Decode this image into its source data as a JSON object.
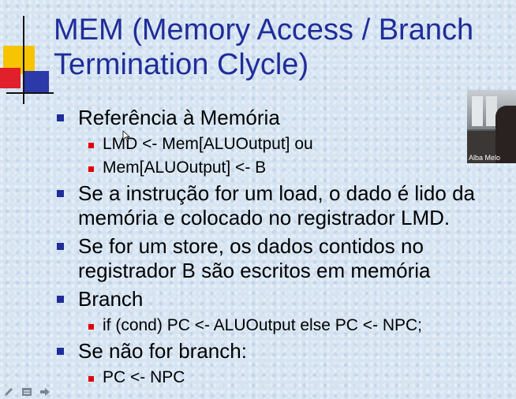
{
  "slide": {
    "title": "MEM (Memory Access / Branch Termination Clycle)",
    "bullets": [
      {
        "text": "Referência à Memória",
        "sub": [
          "LMD <- Mem[ALUOutput] ou",
          "Mem[ALUOutput] <- B"
        ]
      },
      {
        "text": "Se a instrução for um load, o dado é lido da memória e colocado no registrador LMD.",
        "sub": []
      },
      {
        "text": "Se for um store, os dados contidos no registrador B são escritos em memória",
        "sub": []
      },
      {
        "text": "Branch",
        "sub": [
          "if (cond) PC <- ALUOutput else PC <- NPC;"
        ]
      },
      {
        "text": "Se não for branch:",
        "sub": [
          "PC <- NPC"
        ]
      }
    ]
  },
  "webcam": {
    "name": "Alba Melo"
  },
  "toolbar": {
    "icons": [
      "pen-icon",
      "slides-menu-icon",
      "next-arrow-icon"
    ]
  },
  "colors": {
    "title": "#1f2d99",
    "level1_bullet": "#1f2d99",
    "level2_bullet": "#e00000",
    "background": "#d6e4f2"
  }
}
